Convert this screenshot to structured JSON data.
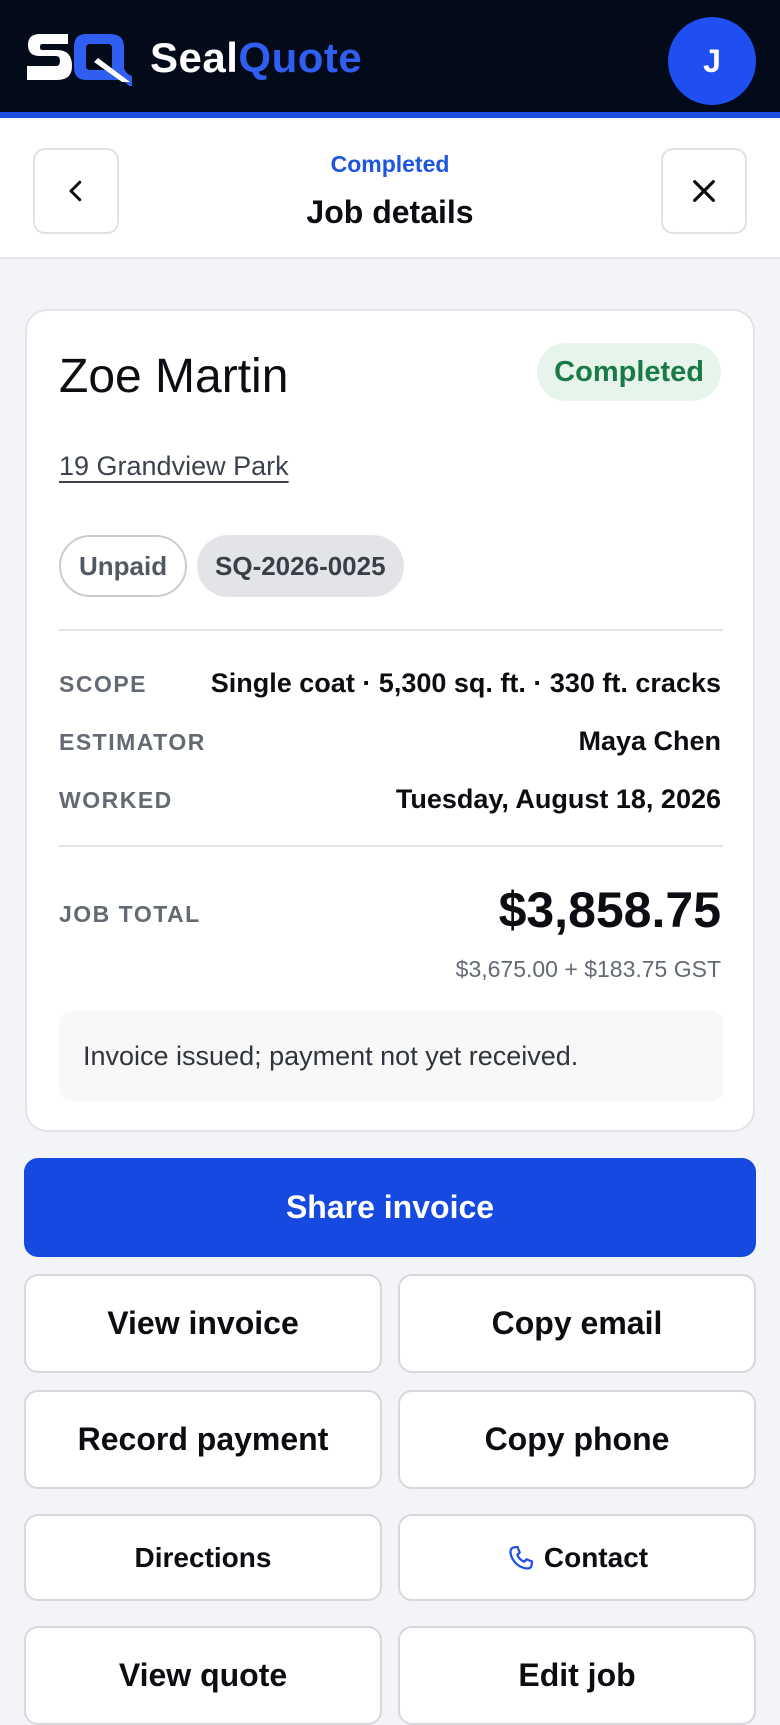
{
  "app": {
    "brand_part1": "Seal",
    "brand_part2": "Quote",
    "avatar_initial": "J"
  },
  "subheader": {
    "status": "Completed",
    "title": "Job details"
  },
  "job": {
    "client_name": "Zoe Martin",
    "status_badge": "Completed",
    "address": "19 Grandview Park",
    "payment_chip": "Unpaid",
    "reference": "SQ-2026-0025",
    "details": [
      {
        "label": "SCOPE",
        "value": "Single coat · 5,300 sq. ft. · 330 ft. cracks"
      },
      {
        "label": "ESTIMATOR",
        "value": "Maya Chen"
      },
      {
        "label": "WORKED",
        "value": "Tuesday, August 18, 2026"
      }
    ],
    "total_label": "JOB TOTAL",
    "total_value": "$3,858.75",
    "total_breakdown": "$3,675.00 + $183.75 GST",
    "note": "Invoice issued; payment not yet received."
  },
  "actions": {
    "share_invoice": "Share invoice",
    "view_invoice": "View invoice",
    "copy_email": "Copy email",
    "record_payment": "Record payment",
    "copy_phone": "Copy phone",
    "directions": "Directions",
    "contact": "Contact",
    "view_quote": "View quote",
    "edit_job": "Edit job"
  },
  "colors": {
    "accent": "#1549e0",
    "topbar": "#030a1a",
    "success": "#1a7a45",
    "success_bg": "#e7f4ec"
  },
  "icons": {
    "back": "chevron-left-icon",
    "close": "close-icon",
    "contact": "phone-icon"
  }
}
